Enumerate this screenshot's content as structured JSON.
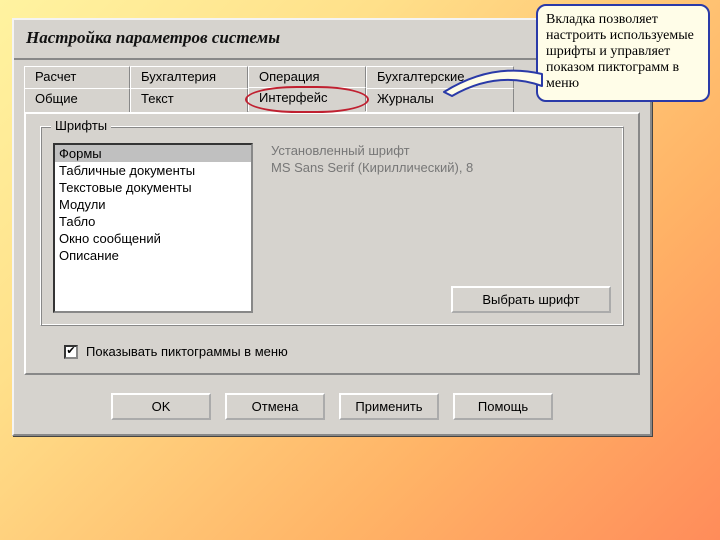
{
  "window": {
    "title": "Настройка параметров системы"
  },
  "tabs": {
    "row1": [
      "Расчет",
      "Бухгалтерия",
      "Операция",
      "Бухгалтерские"
    ],
    "row2": [
      "Общие",
      "Текст",
      "Интерфейс",
      "Журналы"
    ],
    "active": "Интерфейс"
  },
  "group": {
    "label": "Шрифты",
    "list": [
      "Формы",
      "Табличные документы",
      "Текстовые документы",
      "Модули",
      "Табло",
      "Окно сообщений",
      "Описание"
    ],
    "selected_index": 0,
    "font_field_label": "Установленный шрифт",
    "font_value": "MS Sans Serif (Кириллический), 8",
    "choose_font_label": "Выбрать шрифт"
  },
  "checkbox": {
    "label": "Показывать пиктограммы в меню",
    "checked": true
  },
  "buttons": {
    "ok": "OK",
    "cancel": "Отмена",
    "apply": "Применить",
    "help": "Помощь"
  },
  "callout": {
    "text": "Вкладка позволяет настроить используемые шрифты и управляет показом пиктограмм в меню"
  }
}
